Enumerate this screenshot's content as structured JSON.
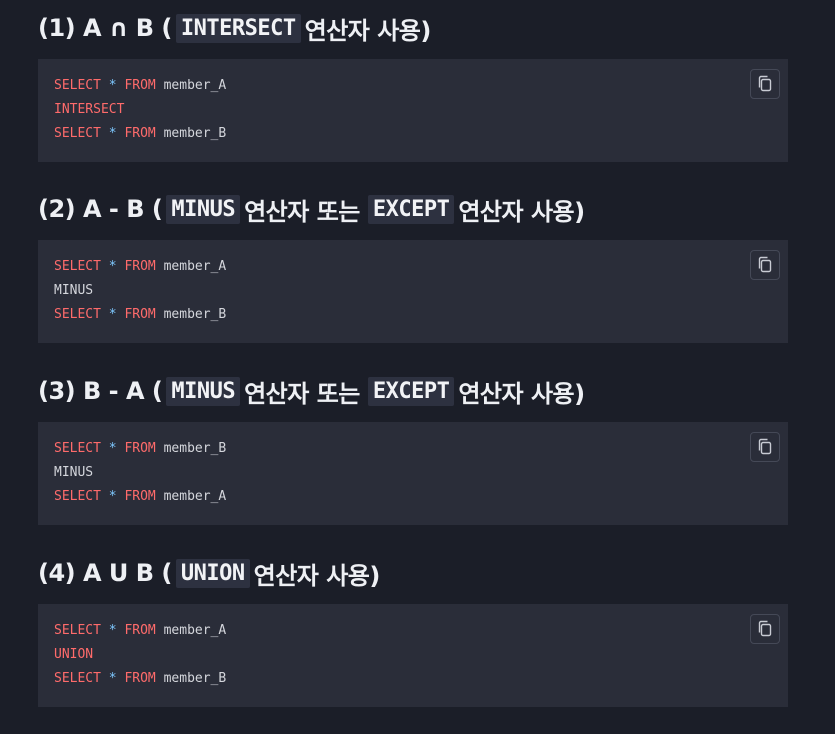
{
  "sections": [
    {
      "heading": {
        "prefix": "(1) A ∩ B (",
        "code1": "INTERSECT",
        "text1": "연산자 사용)"
      },
      "code": {
        "l1_kw1": "SELECT",
        "l1_op": "*",
        "l1_kw2": "FROM",
        "l1_table": "member_A",
        "l2": "INTERSECT",
        "l3_kw1": "SELECT",
        "l3_op": "*",
        "l3_kw2": "FROM",
        "l3_table": "member_B"
      }
    },
    {
      "heading": {
        "prefix": "(2) A - B (",
        "code1": "MINUS",
        "text1": "연산자 또는",
        "code2": "EXCEPT",
        "text2": "연산자 사용)"
      },
      "code": {
        "l1_kw1": "SELECT",
        "l1_op": "*",
        "l1_kw2": "FROM",
        "l1_table": "member_A",
        "l2": "MINUS",
        "l3_kw1": "SELECT",
        "l3_op": "*",
        "l3_kw2": "FROM",
        "l3_table": "member_B"
      }
    },
    {
      "heading": {
        "prefix": "(3) B - A (",
        "code1": "MINUS",
        "text1": "연산자 또는",
        "code2": "EXCEPT",
        "text2": "연산자 사용)"
      },
      "code": {
        "l1_kw1": "SELECT",
        "l1_op": "*",
        "l1_kw2": "FROM",
        "l1_table": "member_B",
        "l2": "MINUS",
        "l3_kw1": "SELECT",
        "l3_op": "*",
        "l3_kw2": "FROM",
        "l3_table": "member_A"
      }
    },
    {
      "heading": {
        "prefix": "(4) A U B (",
        "code1": "UNION",
        "text1": "연산자 사용)"
      },
      "code": {
        "l1_kw1": "SELECT",
        "l1_op": "*",
        "l1_kw2": "FROM",
        "l1_table": "member_A",
        "l2": "UNION",
        "l3_kw1": "SELECT",
        "l3_op": "*",
        "l3_kw2": "FROM",
        "l3_table": "member_B"
      }
    }
  ],
  "icons": {
    "copy": "copy-icon"
  },
  "colors": {
    "keyword": "#ff6b6b",
    "operator": "#7ec8ff",
    "background": "#1b1e28",
    "code_bg": "#2a2d39"
  }
}
